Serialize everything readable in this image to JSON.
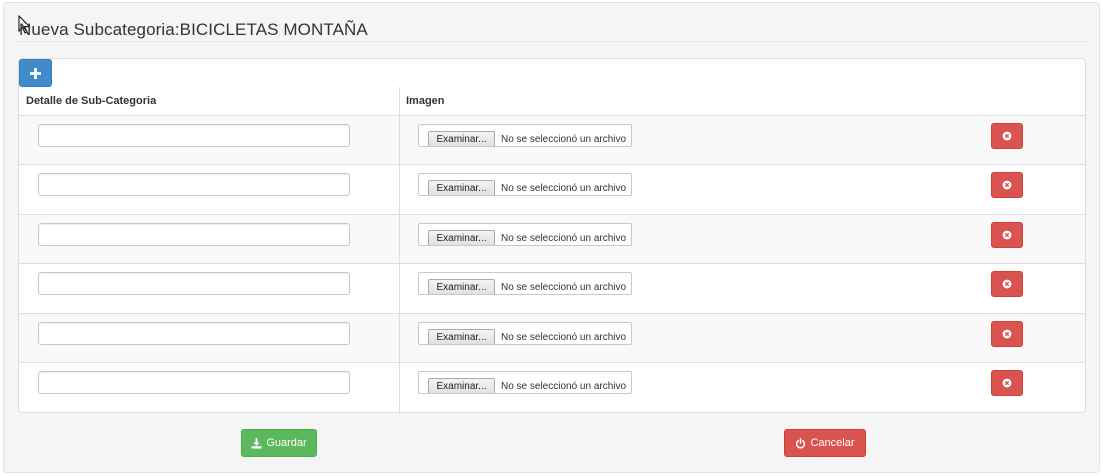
{
  "page": {
    "title": "Nueva Subcategoria:BICICLETAS MONTAÑA"
  },
  "toolbar": {
    "add_icon": "plus-icon"
  },
  "table": {
    "columns": [
      "Detalle de Sub-Categoria",
      "Imagen"
    ],
    "rows": [
      {
        "detail_value": "",
        "file_button": "Examinar...",
        "file_status": "No se seleccionó un archivo"
      },
      {
        "detail_value": "",
        "file_button": "Examinar...",
        "file_status": "No se seleccionó un archivo"
      },
      {
        "detail_value": "",
        "file_button": "Examinar...",
        "file_status": "No se seleccionó un archivo"
      },
      {
        "detail_value": "",
        "file_button": "Examinar...",
        "file_status": "No se seleccionó un archivo"
      },
      {
        "detail_value": "",
        "file_button": "Examinar...",
        "file_status": "No se seleccionó un archivo"
      },
      {
        "detail_value": "",
        "file_button": "Examinar...",
        "file_status": "No se seleccionó un archivo"
      }
    ],
    "row_delete_icon": "remove-circle-icon"
  },
  "actions": {
    "save_label": "Guardar",
    "save_icon": "download-icon",
    "cancel_label": "Cancelar",
    "cancel_icon": "power-icon"
  },
  "colors": {
    "primary": "#428bca",
    "success": "#5cb85c",
    "danger": "#d9534f",
    "well_bg": "#f5f5f5",
    "row_stripe": "#f9f9f9"
  }
}
